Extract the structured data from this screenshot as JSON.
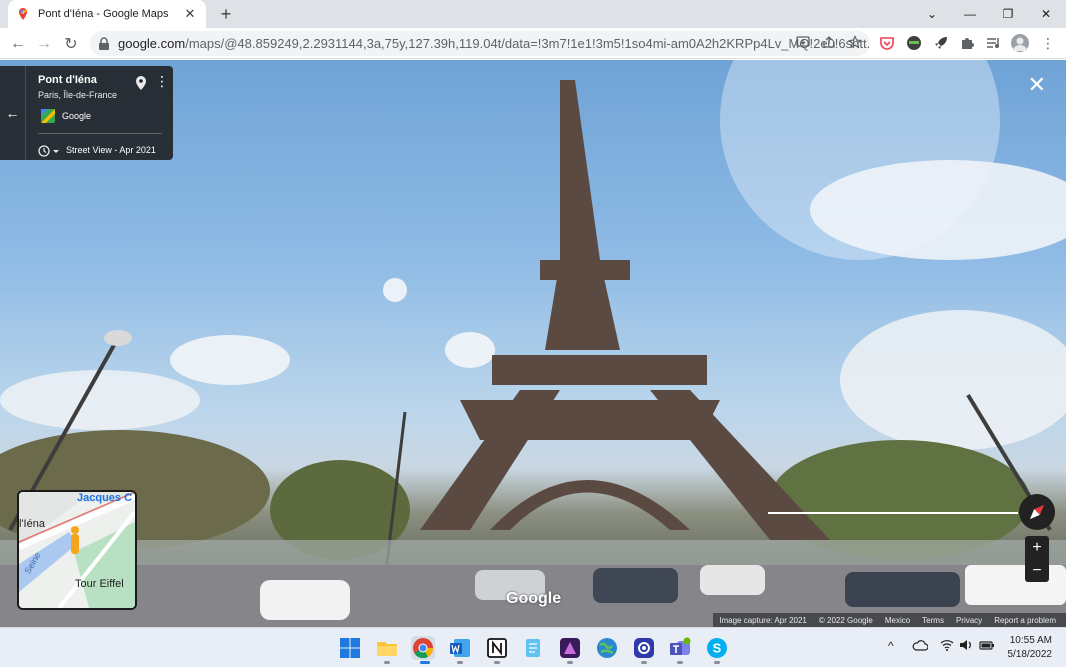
{
  "browser": {
    "tab_title": "Pont d'Iéna - Google Maps",
    "tab_close": "✕",
    "new_tab": "+",
    "url_host": "google.com",
    "url_path": "/maps/@48.859249,2.2931144,3a,75y,127.39h,119.04t/data=!3m7!1e1!3m5!1so4mi-am0A2h2KRPp4Lv_MQ!2e0!6shtt...",
    "window_controls": {
      "chevron": "⌄",
      "minimize": "—",
      "maximize": "❐",
      "close": "✕"
    },
    "nav": {
      "back": "←",
      "forward": "→",
      "reload": "↻"
    },
    "extensions": [
      "pocket-icon",
      "spy-icon",
      "rocket-icon",
      "puzzle-icon",
      "media-icon",
      "profile-avatar",
      "menu-icon"
    ]
  },
  "streetview": {
    "place_name": "Pont d'Iéna",
    "region": "Paris, Île-de-France",
    "contributor": "Google",
    "date_label": "Street View - Apr 2021",
    "back_arrow": "←",
    "close": "✕",
    "more": "⋮",
    "minimap": {
      "label_top": "Jacques C",
      "label_left": "l'Iéna",
      "label_river": "Seine",
      "label_poi": "Tour Eiffel"
    },
    "zoom_in": "+",
    "zoom_out": "−",
    "watermark": "Google",
    "footer": {
      "capture": "Image capture: Apr 2021",
      "copyright": "© 2022 Google",
      "country": "Mexico",
      "terms": "Terms",
      "privacy": "Privacy",
      "report": "Report a problem"
    }
  },
  "taskbar": {
    "apps": [
      "windows-start",
      "file-explorer",
      "chrome",
      "word",
      "notion",
      "notepad",
      "affinity",
      "globe-app",
      "screen-recorder",
      "teams",
      "skype"
    ],
    "tray": {
      "chevron": "^",
      "time": "10:55 AM",
      "date": "5/18/2022"
    }
  }
}
